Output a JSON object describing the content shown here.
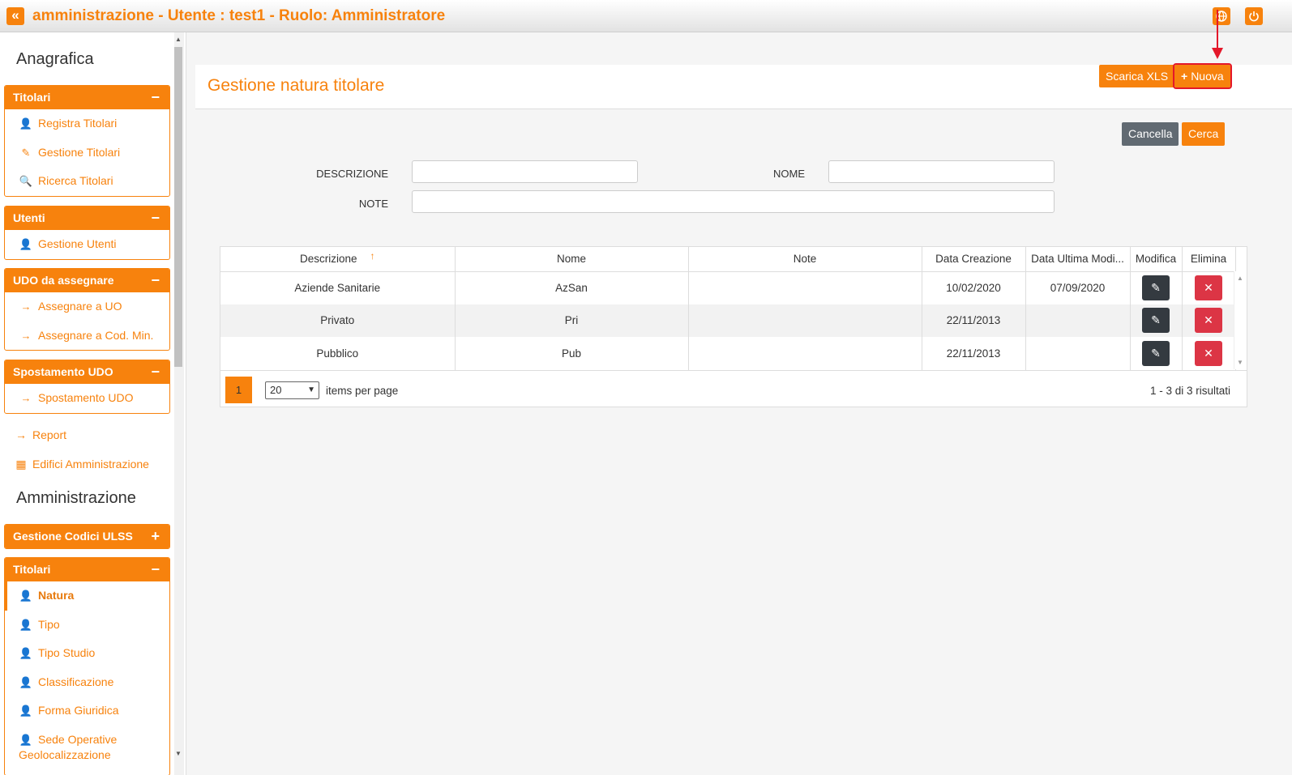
{
  "topbar": {
    "title": "amministrazione - Utente : test1 - Ruolo: Amministratore",
    "collapse_icon": "«",
    "globe_icon": "globe-icon",
    "power_icon": "power-icon"
  },
  "sidebar": {
    "section_anagrafica": "Anagrafica",
    "panel_titolari": {
      "title": "Titolari",
      "toggle": "−",
      "items": [
        "Registra Titolari",
        "Gestione Titolari",
        "Ricerca Titolari"
      ]
    },
    "panel_utenti": {
      "title": "Utenti",
      "toggle": "−",
      "items": [
        "Gestione Utenti"
      ]
    },
    "panel_udo": {
      "title": "UDO da assegnare",
      "toggle": "−",
      "items": [
        "Assegnare a UO",
        "Assegnare a Cod. Min."
      ]
    },
    "panel_spostamento": {
      "title": "Spostamento UDO",
      "toggle": "−",
      "items": [
        "Spostamento UDO"
      ]
    },
    "link_report": "Report",
    "link_edifici": "Edifici Amministrazione",
    "section_amministrazione": "Amministrazione",
    "panel_codici": {
      "title": "Gestione Codici ULSS",
      "toggle": "+"
    },
    "panel_titolari_admin": {
      "title": "Titolari",
      "toggle": "−",
      "items": [
        "Natura",
        "Tipo",
        "Tipo Studio",
        "Classificazione",
        "Forma Giuridica",
        "Sede Operative Geolocalizzazione"
      ]
    }
  },
  "main": {
    "page_title": "Gestione natura titolare",
    "buttons": {
      "scarica": "Scarica XLS",
      "nuova": "Nuova",
      "cancella": "Cancella",
      "cerca": "Cerca"
    },
    "form": {
      "descrizione_label": "DESCRIZIONE",
      "descrizione_value": "",
      "nome_label": "NOME",
      "nome_value": "",
      "note_label": "NOTE",
      "note_value": ""
    },
    "grid": {
      "columns": [
        "Descrizione",
        "Nome",
        "Note",
        "Data Creazione",
        "Data Ultima Modi...",
        "Modifica",
        "Elimina"
      ],
      "rows": [
        {
          "descrizione": "Aziende Sanitarie",
          "nome": "AzSan",
          "note": "",
          "data_creazione": "10/02/2020",
          "data_modifica": "07/09/2020"
        },
        {
          "descrizione": "Privato",
          "nome": "Pri",
          "note": "",
          "data_creazione": "22/11/2013",
          "data_modifica": ""
        },
        {
          "descrizione": "Pubblico",
          "nome": "Pub",
          "note": "",
          "data_creazione": "22/11/2013",
          "data_modifica": ""
        }
      ],
      "pager": {
        "page": "1",
        "per_page": "20",
        "per_page_label": "items per page",
        "info": "1 - 3 di 3 risultati"
      }
    }
  },
  "colors": {
    "accent": "#f7820d",
    "danger": "#dc3545",
    "dark": "#343a40",
    "grey_button": "#616a72",
    "highlight": "#e4182a"
  }
}
